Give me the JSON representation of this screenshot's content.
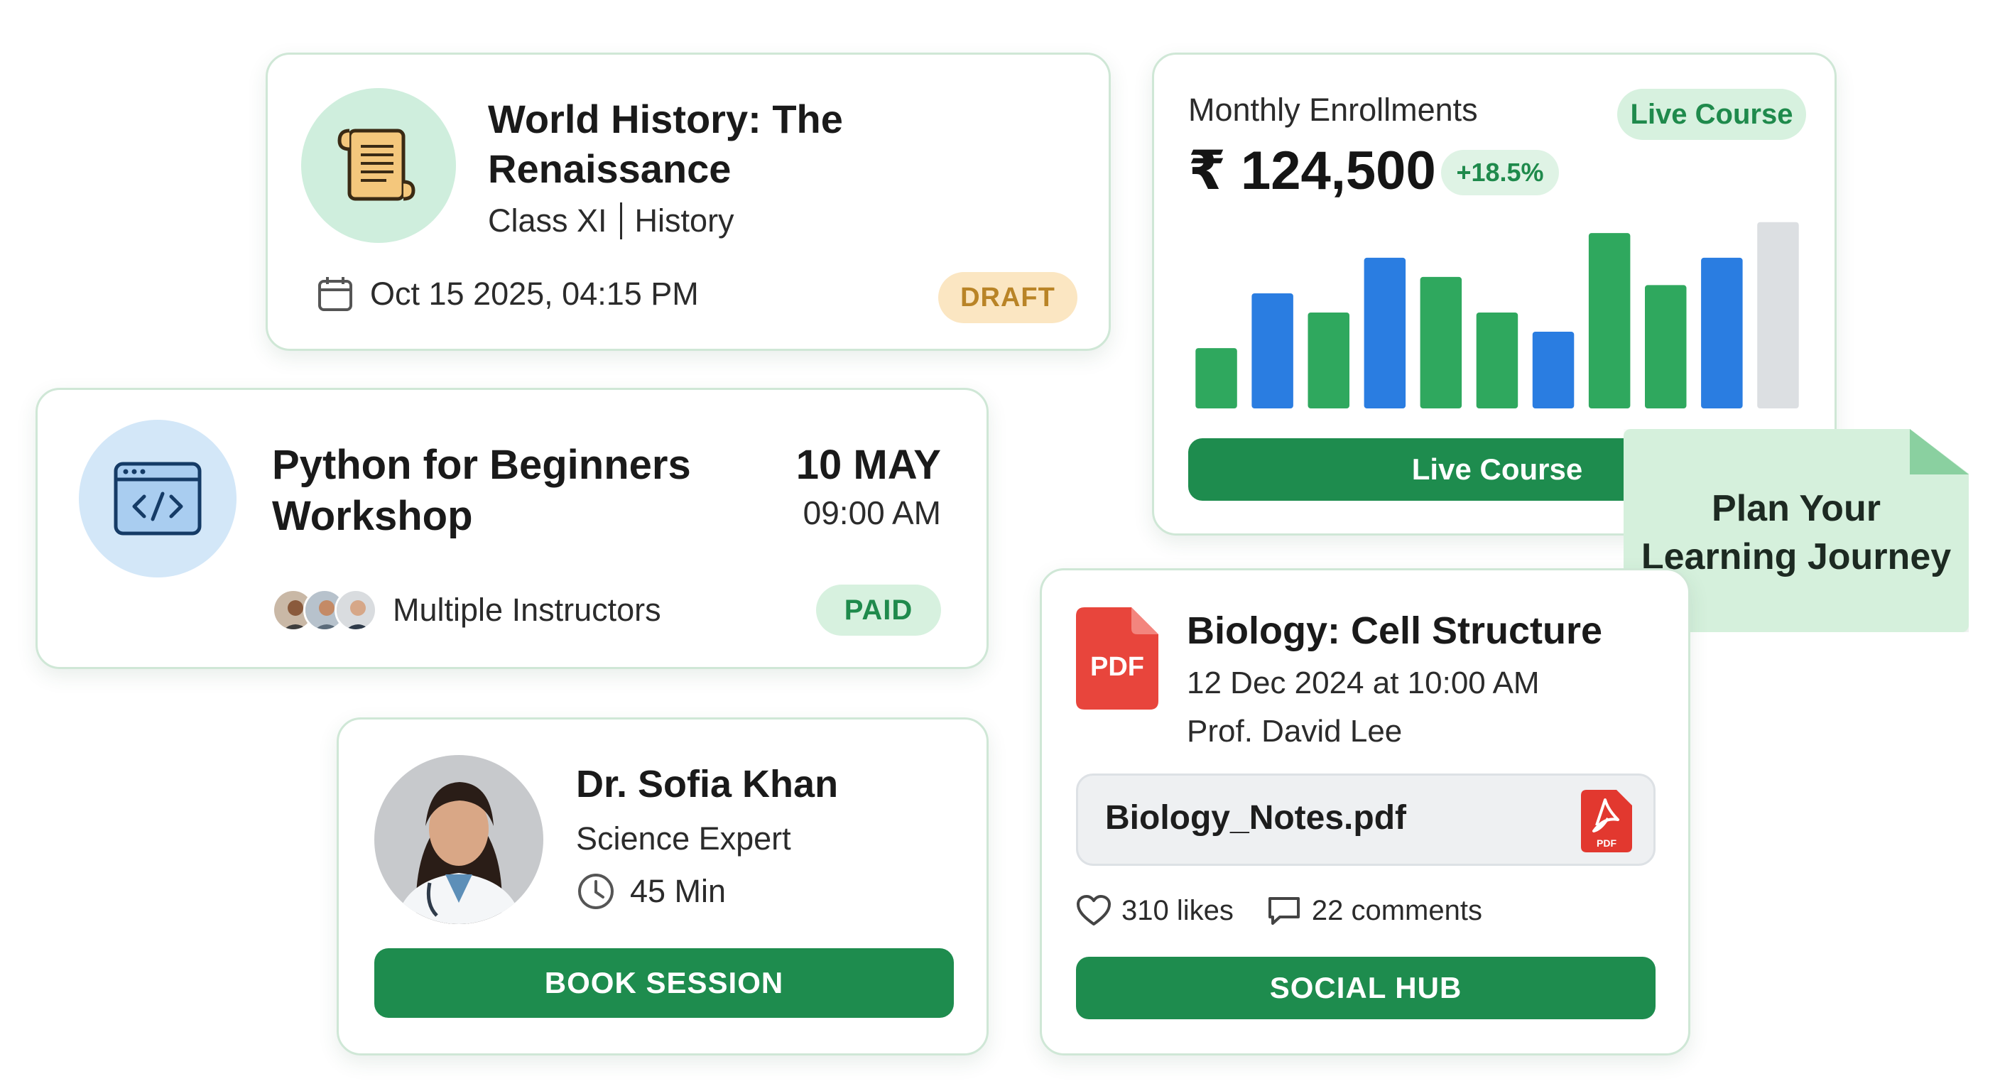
{
  "history_card": {
    "title": "World History: The Renaissance",
    "class_label": "Class XI",
    "subject": "History",
    "datetime": "Oct 15 2025, 04:15 PM",
    "status": "DRAFT",
    "icon": "scroll-icon",
    "colors": {
      "icon_bg": "#cfeedd",
      "badge_bg": "#fbe6c2",
      "badge_text": "#b98427"
    }
  },
  "enrollments_card": {
    "label": "Monthly Enrollments",
    "badge": "Live Course",
    "value": "₹ 124,500",
    "growth": "+18.5%",
    "button_label": "Live Course",
    "colors": {
      "green": "#2fa85e",
      "blue": "#2a7de1",
      "placeholder": "#dcdfe2",
      "button": "#1e8c4e"
    }
  },
  "chart_data": {
    "type": "bar",
    "categories": [
      "",
      "",
      "",
      "",
      "",
      "",
      "",
      "",
      "",
      "",
      ""
    ],
    "values": [
      22,
      42,
      35,
      55,
      48,
      35,
      28,
      64,
      45,
      55,
      68
    ],
    "bar_colors": [
      "green",
      "blue",
      "green",
      "blue",
      "green",
      "green",
      "blue",
      "green",
      "green",
      "blue",
      "gray"
    ],
    "title": "",
    "xlabel": "",
    "ylabel": "",
    "ylim": [
      0,
      70
    ],
    "grid": false,
    "legend": "none"
  },
  "sticky_note": {
    "text_line1": "Plan Your",
    "text_line2": "Learning Journey"
  },
  "python_card": {
    "title_line1": "Python for Beginners",
    "title_line2": "Workshop",
    "date": "10 MAY",
    "time": "09:00 AM",
    "instructors_label": "Multiple Instructors",
    "status": "PAID",
    "icon": "code-window-icon",
    "colors": {
      "icon_bg": "#d3e7f8"
    }
  },
  "sofia_card": {
    "name": "Dr. Sofia Khan",
    "role": "Science Expert",
    "duration": "45 Min",
    "button_label": "BOOK SESSION"
  },
  "biology_card": {
    "title": "Biology: Cell Structure",
    "datetime": "12 Dec 2024 at 10:00 AM",
    "professor": "Prof. David Lee",
    "pdf_badge": "PDF",
    "file_name": "Biology_Notes.pdf",
    "file_badge": "PDF",
    "likes": "310 likes",
    "comments": "22 comments",
    "button_label": "SOCIAL HUB",
    "colors": {
      "pdf_red": "#e8453c"
    }
  }
}
